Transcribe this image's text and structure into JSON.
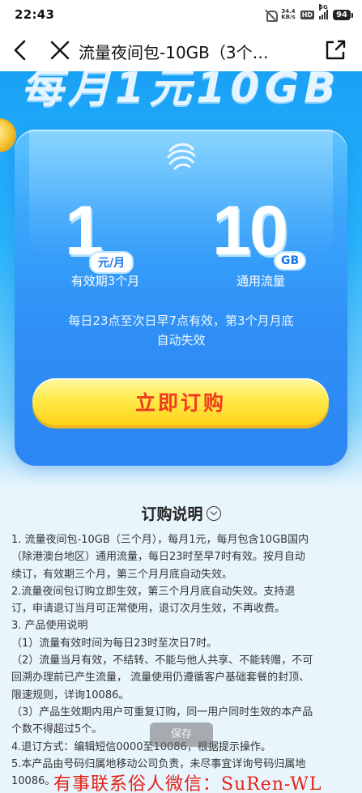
{
  "status_bar": {
    "time": "22:43",
    "net_speed_value": "34.4",
    "net_speed_unit": "KB/s",
    "hd_badge": "HD",
    "network_type": "5G",
    "battery": "94"
  },
  "header": {
    "title": "流量夜间包-10GB（3个…",
    "back_icon": "back-arrow-icon",
    "close_icon": "close-icon",
    "share_icon": "share-icon"
  },
  "hero": {
    "banner_text": "每月1元10GB",
    "price_value": "1",
    "price_unit": "元/月",
    "validity": "有效期3个月",
    "flow_value": "10",
    "flow_unit": "GB",
    "flow_type": "通用流量",
    "description_line1": "每日23点至次日早7点有效，第3个月月底",
    "description_line2": "自动失效",
    "buy_button": "立即订购"
  },
  "instructions": {
    "title": "订购说明",
    "lines": [
      "1. 流量夜间包-10GB（三个月），每月1元，每月包含10GB国内",
      "（除港澳台地区）通用流量，每日23时至早7时有效。按月自动",
      "续订，有效期三个月，第三个月月底自动失效。",
      "2.流量夜间包订购立即生效，第三个月月底自动失效。支持退",
      "订，申请退订当月可正常使用，退订次月生效，不再收费。",
      "3. 产品使用说明",
      "（1）流量有效时间为每日23时至次日7时。",
      "（2）流量当月有效，不结转、不能与他人共享、不能转赠，不可",
      "回溯办理前已产生流量， 流量使用仍遵循客户基础套餐的封顶、",
      "限速规则，详询10086。",
      "（3）产品生效期内用户可重复订购，同一用户同时生效的本产品",
      "个数不得超过5个。",
      "4.退订方式：编辑短信0000至10086，根据提示操作。",
      "5.本产品由号码归属地移动公司负责，未尽事宜详询号码归属地",
      "10086。"
    ]
  },
  "toast": {
    "text": "保存"
  },
  "watermark": {
    "text": "有事联系俗人微信：SuRen-WL"
  },
  "colors": {
    "hero_blue": "#27b2fb",
    "card_blue": "#2f8ff6",
    "button_yellow": "#ffe94a",
    "button_text": "#f03a1e",
    "watermark_red": "#e02418"
  }
}
